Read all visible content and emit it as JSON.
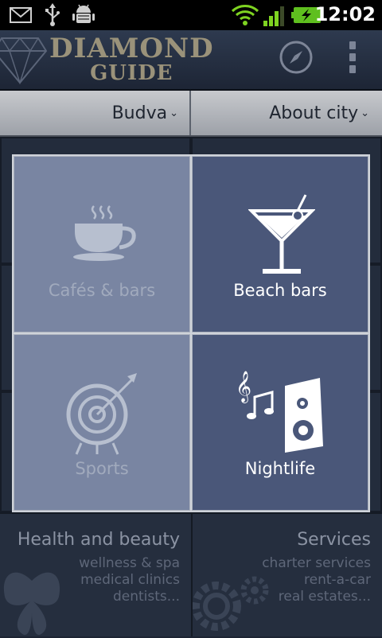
{
  "status_bar": {
    "time": "12:02",
    "icons": [
      "gmail-icon",
      "usb-icon",
      "android-debug-icon",
      "wifi-icon",
      "signal-icon",
      "battery-charging-icon"
    ]
  },
  "app_bar": {
    "logo_line1": "DIAMOND",
    "logo_line2": "GUIDE",
    "actions": [
      "compass-icon",
      "overflow-menu-icon"
    ]
  },
  "city_bar": {
    "city": "Budva",
    "section": "About city"
  },
  "categories": [
    {
      "label": "Cafés & bars",
      "icon": "coffee-cup-icon",
      "active": false
    },
    {
      "label": "Beach bars",
      "icon": "cocktail-icon",
      "active": true
    },
    {
      "label": "Sports",
      "icon": "target-icon",
      "active": false
    },
    {
      "label": "Nightlife",
      "icon": "music-speaker-icon",
      "active": true
    }
  ],
  "bottom_tiles": [
    {
      "title": "Health and beauty",
      "lines": [
        "wellness & spa",
        "medical clinics",
        "dentists..."
      ]
    },
    {
      "title": "Services",
      "lines": [
        "charter services",
        "rent-a-car",
        "real estates..."
      ]
    }
  ],
  "colors": {
    "status_bar": "#000000",
    "tile_light": "#7985a2",
    "tile_dark": "#4a5779",
    "background": "#1c2433"
  }
}
